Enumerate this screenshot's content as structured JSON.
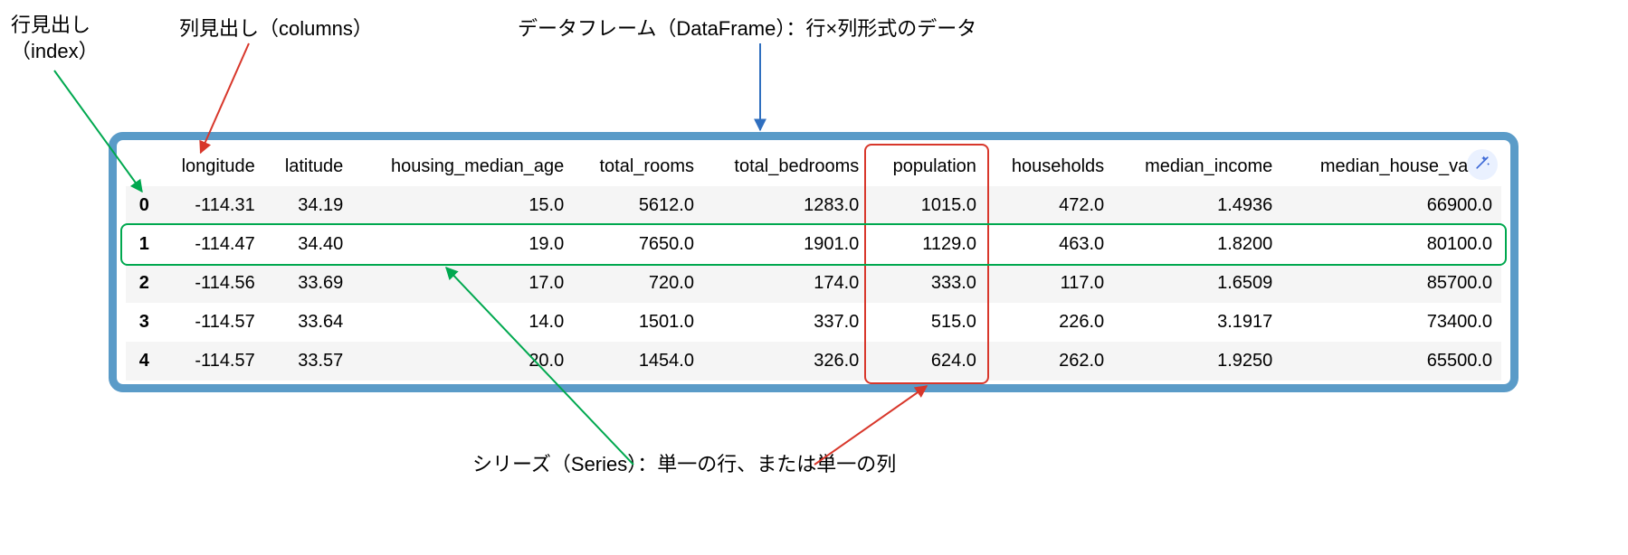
{
  "annotations": {
    "index_label": "行見出し\n（index）",
    "columns_label": "列見出し（columns）",
    "dataframe_label": "データフレーム（DataFrame）：行×列形式のデータ",
    "series_label": "シリーズ（Series）：単一の行、または単一の列"
  },
  "columns": [
    "longitude",
    "latitude",
    "housing_median_age",
    "total_rooms",
    "total_bedrooms",
    "population",
    "households",
    "median_income",
    "median_house_value"
  ],
  "index": [
    "0",
    "1",
    "2",
    "3",
    "4"
  ],
  "data": [
    [
      "-114.31",
      "34.19",
      "15.0",
      "5612.0",
      "1283.0",
      "1015.0",
      "472.0",
      "1.4936",
      "66900.0"
    ],
    [
      "-114.47",
      "34.40",
      "19.0",
      "7650.0",
      "1901.0",
      "1129.0",
      "463.0",
      "1.8200",
      "80100.0"
    ],
    [
      "-114.56",
      "33.69",
      "17.0",
      "720.0",
      "174.0",
      "333.0",
      "117.0",
      "1.6509",
      "85700.0"
    ],
    [
      "-114.57",
      "33.64",
      "14.0",
      "1501.0",
      "337.0",
      "515.0",
      "226.0",
      "3.1917",
      "73400.0"
    ],
    [
      "-114.57",
      "33.57",
      "20.0",
      "1454.0",
      "326.0",
      "624.0",
      "262.0",
      "1.9250",
      "65500.0"
    ]
  ],
  "highlight_column": "population",
  "highlight_row_index": 1,
  "colors": {
    "frame_border": "#5a9bc8",
    "arrow_green": "#00a84f",
    "arrow_red": "#d8372b",
    "arrow_blue": "#2f6fbf",
    "text": "#000000",
    "wand_bg": "#eaf1ff",
    "wand_stroke": "#3a67d6"
  }
}
